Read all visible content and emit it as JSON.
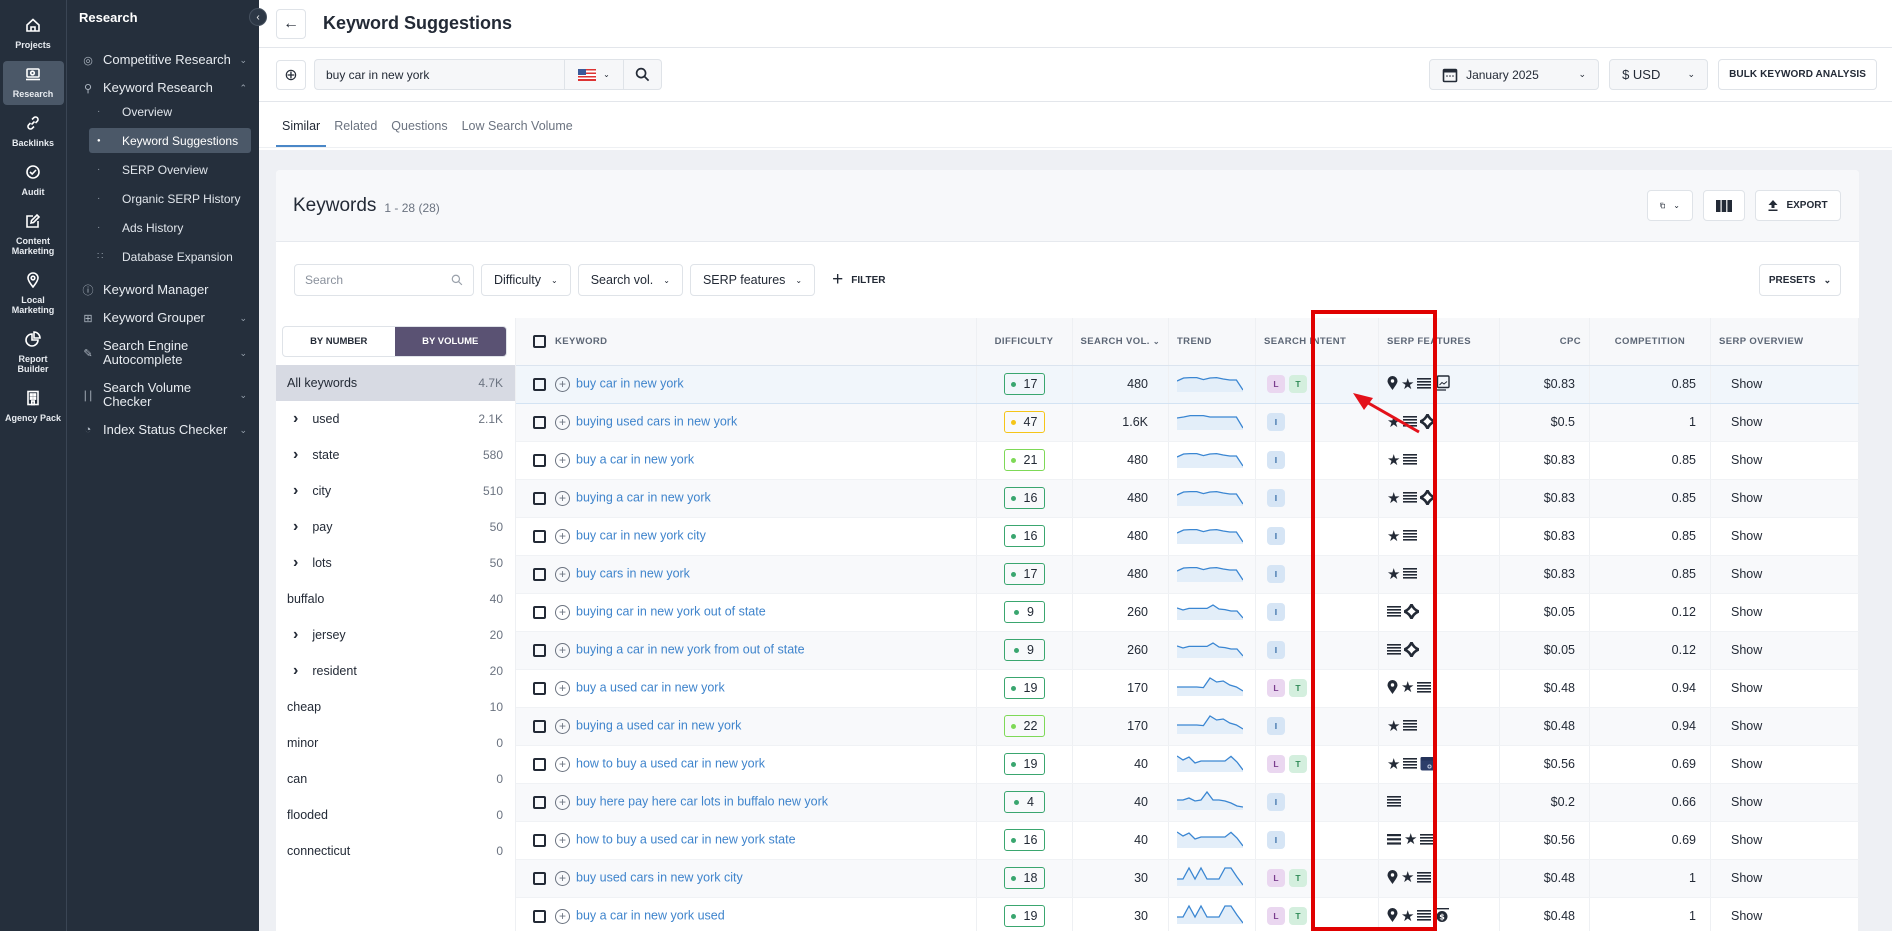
{
  "rail": [
    {
      "label": "Projects",
      "icon": "home-icon"
    },
    {
      "label": "Research",
      "icon": "research-icon",
      "active": true
    },
    {
      "label": "Backlinks",
      "icon": "link-icon"
    },
    {
      "label": "Audit",
      "icon": "check-circle-icon"
    },
    {
      "label": "Content Marketing",
      "icon": "edit-icon"
    },
    {
      "label": "Local Marketing",
      "icon": "location-icon"
    },
    {
      "label": "Report Builder",
      "icon": "pie-chart-icon"
    },
    {
      "label": "Agency Pack",
      "icon": "building-icon"
    }
  ],
  "nav": {
    "title": "Research",
    "groups": [
      {
        "label": "Competitive Research",
        "icon": "target-icon",
        "expanded": false
      },
      {
        "label": "Keyword Research",
        "icon": "key-icon",
        "expanded": true,
        "items": [
          {
            "label": "Overview"
          },
          {
            "label": "Keyword Suggestions",
            "active": true
          },
          {
            "label": "SERP Overview"
          },
          {
            "label": "Organic SERP History"
          },
          {
            "label": "Ads History"
          },
          {
            "label": "Database Expansion"
          }
        ]
      },
      {
        "label": "Keyword Manager",
        "icon": "info-circle-icon"
      },
      {
        "label": "Keyword Grouper",
        "icon": "folder-plus-icon",
        "expanded": false
      },
      {
        "label": "Search Engine Autocomplete",
        "icon": "pencil-icon",
        "expanded": false
      },
      {
        "label": "Search Volume Checker",
        "icon": "bar-chart-icon",
        "expanded": false
      },
      {
        "label": "Index Status Checker",
        "icon": "gauge-icon",
        "expanded": false
      }
    ]
  },
  "header": {
    "title": "Keyword Suggestions"
  },
  "search": {
    "query": "buy car in new york",
    "country": "US",
    "date": "January 2025",
    "currency": "$ USD",
    "bulk_label": "BULK KEYWORD ANALYSIS"
  },
  "tabs": [
    {
      "label": "Similar",
      "active": true
    },
    {
      "label": "Related"
    },
    {
      "label": "Questions"
    },
    {
      "label": "Low Search Volume"
    }
  ],
  "card": {
    "title": "Keywords",
    "count": "1 - 28 (28)",
    "export_label": "EXPORT",
    "presets_label": "PRESETS",
    "search_placeholder": "Search",
    "filters": [
      "Difficulty",
      "Search vol.",
      "SERP features"
    ],
    "add_filter_label": "FILTER"
  },
  "grouping": {
    "toggle": [
      {
        "label": "BY NUMBER"
      },
      {
        "label": "BY VOLUME",
        "active": true
      }
    ],
    "groups": [
      {
        "name": "All keywords",
        "value": "4.7K",
        "selected": true,
        "expandable": false,
        "root": true
      },
      {
        "name": "used",
        "value": "2.1K",
        "expandable": true
      },
      {
        "name": "state",
        "value": "580",
        "expandable": true
      },
      {
        "name": "city",
        "value": "510",
        "expandable": true
      },
      {
        "name": "pay",
        "value": "50",
        "expandable": true
      },
      {
        "name": "lots",
        "value": "50",
        "expandable": true
      },
      {
        "name": "buffalo",
        "value": "40",
        "expandable": false
      },
      {
        "name": "jersey",
        "value": "20",
        "expandable": true
      },
      {
        "name": "resident",
        "value": "20",
        "expandable": true
      },
      {
        "name": "cheap",
        "value": "10",
        "expandable": false
      },
      {
        "name": "minor",
        "value": "0",
        "expandable": false
      },
      {
        "name": "can",
        "value": "0",
        "expandable": false
      },
      {
        "name": "flooded",
        "value": "0",
        "expandable": false
      },
      {
        "name": "connecticut",
        "value": "0",
        "expandable": false
      }
    ]
  },
  "table": {
    "columns": [
      "KEYWORD",
      "DIFFICULTY",
      "SEARCH VOL.",
      "TREND",
      "SEARCH INTENT",
      "SERP FEATURES",
      "CPC",
      "COMPETITION",
      "SERP OVERVIEW"
    ],
    "difficulty_colors": {
      "easy": "#3aa66f",
      "medium_easy": "#7ed957",
      "medium": "#f5c518"
    },
    "rows": [
      {
        "keyword": "buy car in new york",
        "difficulty": 17,
        "level": "easy",
        "volume": "480",
        "trend": [
          0.55,
          0.7,
          0.72,
          0.72,
          0.62,
          0.7,
          0.72,
          0.65,
          0.6,
          0.6,
          0.1
        ],
        "intent": [
          "L",
          "T"
        ],
        "serp": [
          "local-pack",
          "featured-star",
          "list",
          "images"
        ],
        "cpc": "$0.83",
        "competition": "0.85",
        "overview": "Show",
        "highlighted": true
      },
      {
        "keyword": "buying used cars in new york",
        "difficulty": 47,
        "level": "medium",
        "volume": "1.6K",
        "trend": [
          0.6,
          0.65,
          0.72,
          0.72,
          0.72,
          0.65,
          0.65,
          0.65,
          0.65,
          0.65,
          0.1
        ],
        "intent": [
          "I"
        ],
        "serp": [
          "featured-star",
          "list",
          "sitelinks"
        ],
        "cpc": "$0.5",
        "competition": "1",
        "overview": "Show"
      },
      {
        "keyword": "buy a car in new york",
        "difficulty": 21,
        "level": "medium_easy",
        "volume": "480",
        "trend": [
          0.55,
          0.7,
          0.72,
          0.72,
          0.62,
          0.7,
          0.72,
          0.65,
          0.6,
          0.6,
          0.1
        ],
        "intent": [
          "I"
        ],
        "serp": [
          "featured-star",
          "list"
        ],
        "cpc": "$0.83",
        "competition": "0.85",
        "overview": "Show"
      },
      {
        "keyword": "buying a car in new york",
        "difficulty": 16,
        "level": "easy",
        "volume": "480",
        "trend": [
          0.55,
          0.7,
          0.72,
          0.72,
          0.62,
          0.7,
          0.72,
          0.65,
          0.6,
          0.6,
          0.1
        ],
        "intent": [
          "I"
        ],
        "serp": [
          "featured-star",
          "list",
          "sitelinks"
        ],
        "cpc": "$0.83",
        "competition": "0.85",
        "overview": "Show"
      },
      {
        "keyword": "buy car in new york city",
        "difficulty": 16,
        "level": "easy",
        "volume": "480",
        "trend": [
          0.55,
          0.7,
          0.72,
          0.72,
          0.62,
          0.7,
          0.72,
          0.65,
          0.6,
          0.6,
          0.1
        ],
        "intent": [
          "I"
        ],
        "serp": [
          "featured-star",
          "list"
        ],
        "cpc": "$0.83",
        "competition": "0.85",
        "overview": "Show"
      },
      {
        "keyword": "buy cars in new york",
        "difficulty": 17,
        "level": "easy",
        "volume": "480",
        "trend": [
          0.55,
          0.7,
          0.72,
          0.72,
          0.62,
          0.7,
          0.72,
          0.65,
          0.6,
          0.6,
          0.1
        ],
        "intent": [
          "I"
        ],
        "serp": [
          "featured-star",
          "list"
        ],
        "cpc": "$0.83",
        "competition": "0.85",
        "overview": "Show"
      },
      {
        "keyword": "buying car in new york out of state",
        "difficulty": 9,
        "level": "easy",
        "volume": "260",
        "trend": [
          0.6,
          0.5,
          0.58,
          0.58,
          0.58,
          0.58,
          0.75,
          0.55,
          0.52,
          0.45,
          0.45,
          0.1
        ],
        "intent": [
          "I"
        ],
        "serp": [
          "list",
          "sitelinks"
        ],
        "cpc": "$0.05",
        "competition": "0.12",
        "overview": "Show"
      },
      {
        "keyword": "buying a car in new york from out of state",
        "difficulty": 9,
        "level": "easy",
        "volume": "260",
        "trend": [
          0.6,
          0.5,
          0.58,
          0.58,
          0.58,
          0.58,
          0.75,
          0.55,
          0.52,
          0.45,
          0.45,
          0.1
        ],
        "intent": [
          "I"
        ],
        "serp": [
          "list",
          "sitelinks"
        ],
        "cpc": "$0.05",
        "competition": "0.12",
        "overview": "Show"
      },
      {
        "keyword": "buy a used car in new york",
        "difficulty": 19,
        "level": "easy",
        "volume": "170",
        "trend": [
          0.45,
          0.45,
          0.45,
          0.45,
          0.42,
          0.9,
          0.7,
          0.75,
          0.55,
          0.45,
          0.25
        ],
        "intent": [
          "L",
          "T"
        ],
        "serp": [
          "local-pack",
          "featured-star",
          "list"
        ],
        "cpc": "$0.48",
        "competition": "0.94",
        "overview": "Show"
      },
      {
        "keyword": "buying a used car in new york",
        "difficulty": 22,
        "level": "medium_easy",
        "volume": "170",
        "trend": [
          0.45,
          0.45,
          0.45,
          0.45,
          0.42,
          0.9,
          0.7,
          0.75,
          0.55,
          0.45,
          0.25
        ],
        "intent": [
          "I"
        ],
        "serp": [
          "featured-star",
          "list"
        ],
        "cpc": "$0.48",
        "competition": "0.94",
        "overview": "Show"
      },
      {
        "keyword": "how to buy a used car in new york",
        "difficulty": 19,
        "level": "easy",
        "volume": "40",
        "trend": [
          0.8,
          0.6,
          0.75,
          0.45,
          0.55,
          0.55,
          0.55,
          0.55,
          0.55,
          0.78,
          0.5,
          0.1
        ],
        "intent": [
          "L",
          "T"
        ],
        "serp": [
          "featured-star",
          "list",
          "calendar"
        ],
        "cpc": "$0.56",
        "competition": "0.69",
        "overview": "Show"
      },
      {
        "keyword": "buy here pay here car lots in buffalo new york",
        "difficulty": 4,
        "level": "easy",
        "volume": "40",
        "trend": [
          0.5,
          0.5,
          0.6,
          0.45,
          0.5,
          0.9,
          0.5,
          0.5,
          0.45,
          0.35,
          0.2,
          0.15
        ],
        "intent": [
          "I"
        ],
        "serp": [
          "list"
        ],
        "cpc": "$0.2",
        "competition": "0.66",
        "overview": "Show"
      },
      {
        "keyword": "how to buy a used car in new york state",
        "difficulty": 16,
        "level": "easy",
        "volume": "40",
        "trend": [
          0.8,
          0.6,
          0.75,
          0.45,
          0.55,
          0.55,
          0.55,
          0.55,
          0.55,
          0.78,
          0.5,
          0.1
        ],
        "intent": [
          "I"
        ],
        "serp": [
          "list-bold",
          "featured-star",
          "list"
        ],
        "cpc": "$0.56",
        "competition": "0.69",
        "overview": "Show"
      },
      {
        "keyword": "buy used cars in new york city",
        "difficulty": 18,
        "level": "easy",
        "volume": "30",
        "trend": [
          0.35,
          0.35,
          0.9,
          0.35,
          0.9,
          0.35,
          0.35,
          0.35,
          0.9,
          0.9,
          0.45,
          0.05
        ],
        "intent": [
          "L",
          "T"
        ],
        "serp": [
          "local-pack",
          "featured-star",
          "list"
        ],
        "cpc": "$0.48",
        "competition": "1",
        "overview": "Show"
      },
      {
        "keyword": "buy a car in new york used",
        "difficulty": 19,
        "level": "easy",
        "volume": "30",
        "trend": [
          0.35,
          0.35,
          0.9,
          0.35,
          0.9,
          0.35,
          0.35,
          0.35,
          0.9,
          0.9,
          0.45,
          0.05
        ],
        "intent": [
          "L",
          "T"
        ],
        "serp": [
          "local-pack",
          "featured-star",
          "list",
          "top-ads"
        ],
        "cpc": "$0.48",
        "competition": "1",
        "overview": "Show"
      }
    ]
  }
}
